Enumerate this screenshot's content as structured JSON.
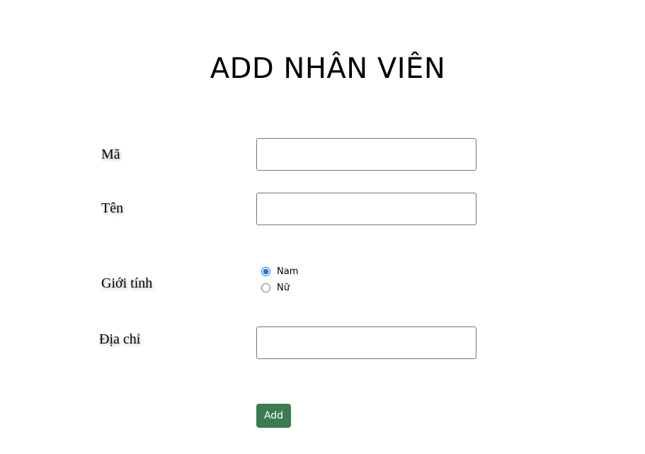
{
  "page": {
    "title": "ADD NHÂN VIÊN"
  },
  "form": {
    "ma": {
      "label": "Mã",
      "value": ""
    },
    "ten": {
      "label": "Tên",
      "value": ""
    },
    "gioi_tinh": {
      "label": "Giới tính",
      "options": [
        {
          "label": "Nam",
          "checked": true
        },
        {
          "label": "Nữ",
          "checked": false
        }
      ]
    },
    "dia_chi": {
      "label": "Địa chỉ",
      "value": ""
    },
    "submit_label": "Add"
  },
  "colors": {
    "button_bg": "#3a7d50",
    "button_text": "#ffffff",
    "radio_accent": "#1a73e8",
    "input_border": "#767676"
  }
}
